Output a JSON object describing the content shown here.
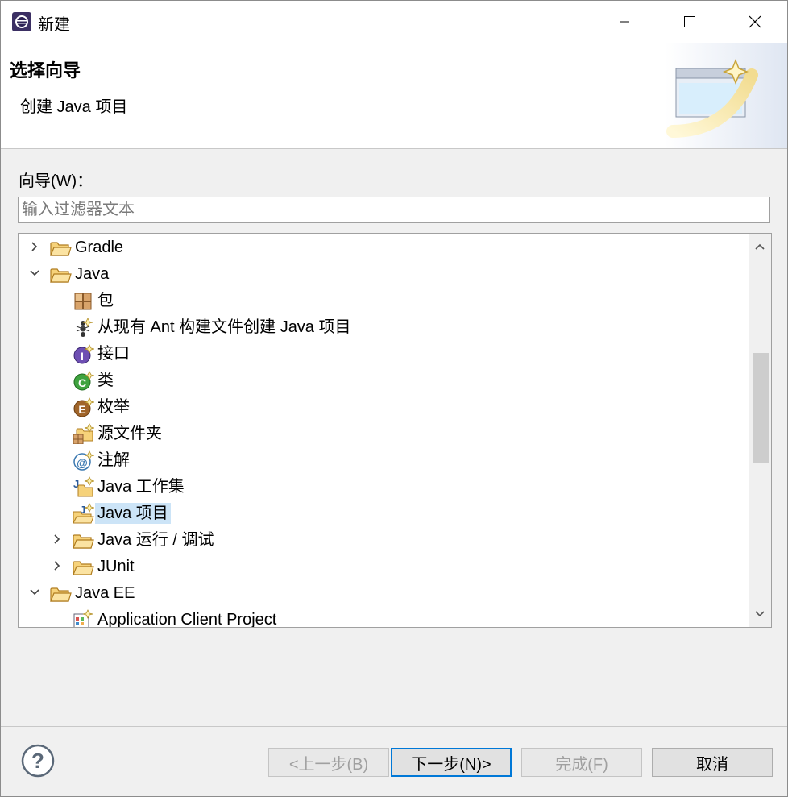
{
  "window": {
    "title": "新建"
  },
  "header": {
    "title": "选择向导",
    "description": "创建 Java 项目"
  },
  "wizards": {
    "label": "向导(W)：",
    "filter_placeholder": "输入过滤器文本",
    "filter_value": ""
  },
  "tree": {
    "items": [
      {
        "label": "Gradle",
        "level": 0,
        "expand": "collapsed",
        "icon": "folder-icon"
      },
      {
        "label": "Java",
        "level": 0,
        "expand": "expanded",
        "icon": "folder-icon"
      },
      {
        "label": "包",
        "level": 1,
        "expand": "none",
        "icon": "package-icon"
      },
      {
        "label": "从现有 Ant 构建文件创建 Java 项目",
        "level": 1,
        "expand": "none",
        "icon": "ant-icon"
      },
      {
        "label": "接口",
        "level": 1,
        "expand": "none",
        "icon": "interface-icon"
      },
      {
        "label": "类",
        "level": 1,
        "expand": "none",
        "icon": "class-icon"
      },
      {
        "label": "枚举",
        "level": 1,
        "expand": "none",
        "icon": "enum-icon"
      },
      {
        "label": "源文件夹",
        "level": 1,
        "expand": "none",
        "icon": "source-folder-icon"
      },
      {
        "label": "注解",
        "level": 1,
        "expand": "none",
        "icon": "annotation-icon"
      },
      {
        "label": "Java 工作集",
        "level": 1,
        "expand": "none",
        "icon": "working-set-icon"
      },
      {
        "label": "Java 项目",
        "level": 1,
        "expand": "none",
        "icon": "java-project-icon",
        "selected": true
      },
      {
        "label": "Java 运行 / 调试",
        "level": 1,
        "expand": "collapsed",
        "icon": "folder-icon"
      },
      {
        "label": "JUnit",
        "level": 1,
        "expand": "collapsed",
        "icon": "folder-icon"
      },
      {
        "label": "Java EE",
        "level": 0,
        "expand": "expanded",
        "icon": "folder-icon"
      },
      {
        "label": "Application Client Project",
        "level": 1,
        "expand": "none",
        "icon": "app-client-project-icon"
      }
    ]
  },
  "buttons": {
    "back": "<上一步(B)",
    "next": "下一步(N)>",
    "finish": "完成(F)",
    "cancel": "取消"
  },
  "colors": {
    "selection": "#cce4f7",
    "accent": "#0078d7",
    "folder": "#f0c060"
  }
}
